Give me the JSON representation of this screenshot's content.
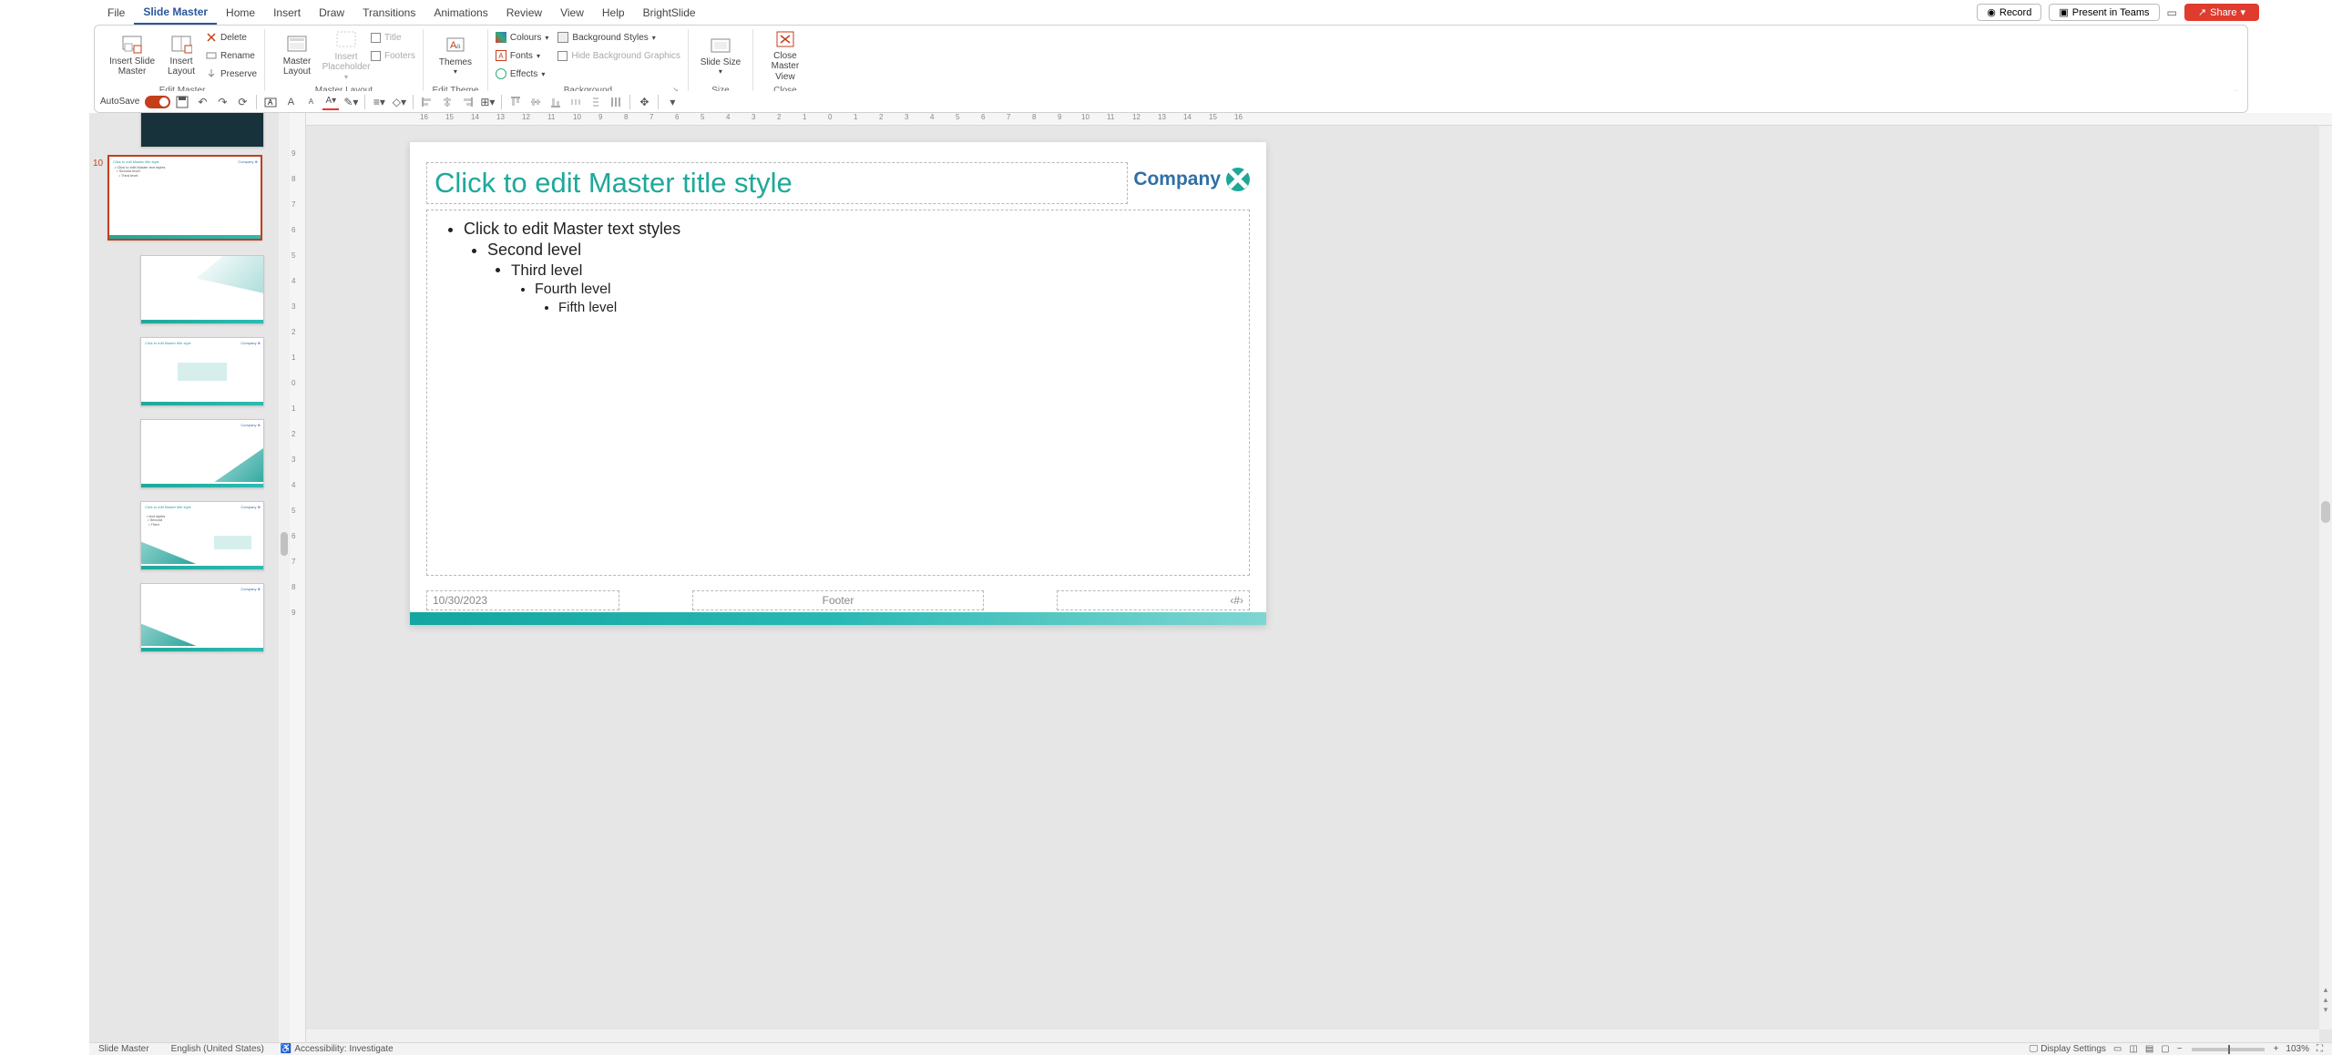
{
  "tabs": {
    "file": "File",
    "slide_master": "Slide Master",
    "home": "Home",
    "insert": "Insert",
    "draw": "Draw",
    "transitions": "Transitions",
    "animations": "Animations",
    "review": "Review",
    "view": "View",
    "help": "Help",
    "brightslide": "BrightSlide"
  },
  "topright": {
    "record": "Record",
    "present": "Present in Teams",
    "share": "Share"
  },
  "ribbon": {
    "edit_master": {
      "label": "Edit Master",
      "insert_slide_master": "Insert Slide Master",
      "insert_layout": "Insert Layout",
      "delete": "Delete",
      "rename": "Rename",
      "preserve": "Preserve"
    },
    "master_layout": {
      "label": "Master Layout",
      "master_layout_btn": "Master Layout",
      "insert_placeholder": "Insert Placeholder",
      "title": "Title",
      "footers": "Footers"
    },
    "edit_theme": {
      "label": "Edit Theme",
      "themes": "Themes"
    },
    "background": {
      "label": "Background",
      "colours": "Colours",
      "fonts": "Fonts",
      "effects": "Effects",
      "bg_styles": "Background Styles",
      "hide_bg": "Hide Background Graphics"
    },
    "size": {
      "label": "Size",
      "slide_size": "Slide Size"
    },
    "close": {
      "label": "Close",
      "close_master": "Close Master View"
    }
  },
  "qat": {
    "autosave": "AutoSave"
  },
  "thumbs": {
    "master_index": "10"
  },
  "hruler_ticks": [
    "16",
    "15",
    "14",
    "13",
    "12",
    "11",
    "10",
    "9",
    "8",
    "7",
    "6",
    "5",
    "4",
    "3",
    "2",
    "1",
    "0",
    "1",
    "2",
    "3",
    "4",
    "5",
    "6",
    "7",
    "8",
    "9",
    "10",
    "11",
    "12",
    "13",
    "14",
    "15",
    "16"
  ],
  "vruler_ticks": [
    "9",
    "8",
    "7",
    "6",
    "5",
    "4",
    "3",
    "2",
    "1",
    "0",
    "1",
    "2",
    "3",
    "4",
    "5",
    "6",
    "7",
    "8",
    "9"
  ],
  "slide": {
    "title_ph": "Click to edit Master title style",
    "body_l1": "Click to edit Master text styles",
    "body_l2": "Second level",
    "body_l3": "Third level",
    "body_l4": "Fourth level",
    "body_l5": "Fifth level",
    "company": "Company",
    "date": "10/30/2023",
    "footer": "Footer",
    "num": "‹#›"
  },
  "status": {
    "view": "Slide Master",
    "lang": "English (United States)",
    "access": "Accessibility: Investigate",
    "display": "Display Settings",
    "zoom": "103%"
  }
}
